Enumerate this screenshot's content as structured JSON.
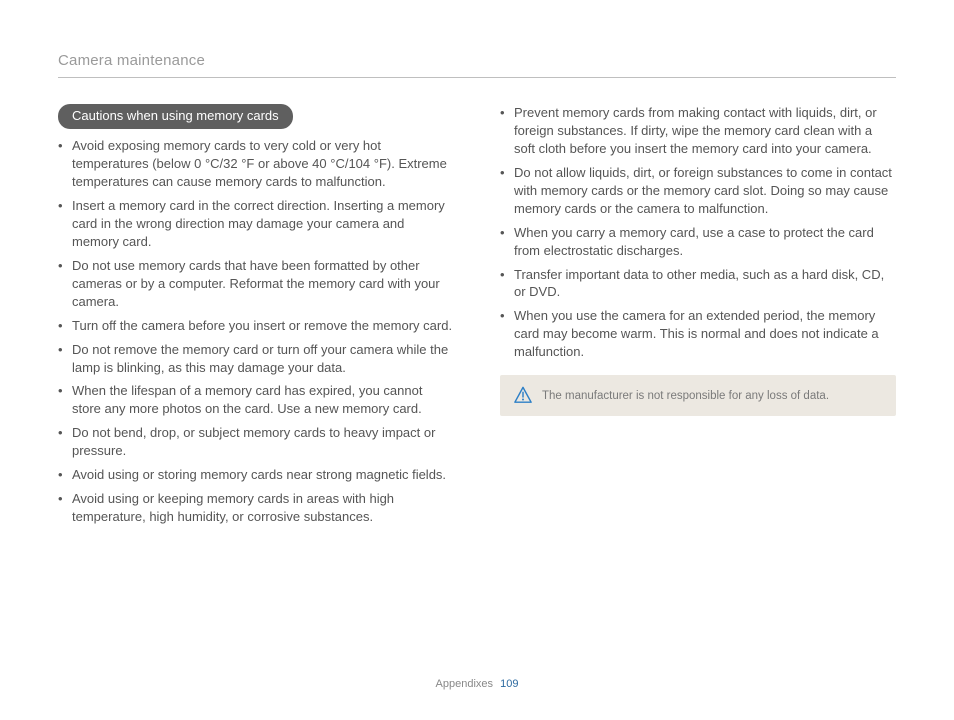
{
  "header": {
    "title": "Camera maintenance"
  },
  "section": {
    "heading": "Cautions when using memory cards"
  },
  "left_bullets": [
    "Avoid exposing memory cards to very cold or very hot temperatures (below 0 °C/32 °F or above 40 °C/104 °F). Extreme temperatures can cause memory cards to malfunction.",
    "Insert a memory card in the correct direction. Inserting a memory card in the wrong direction may damage your camera and memory card.",
    "Do not use memory cards that have been formatted by other cameras or by a computer. Reformat the memory card with your camera.",
    "Turn off the camera before you insert or remove the memory card.",
    "Do not remove the memory card or turn off your camera while the lamp is blinking, as this may damage your data.",
    "When the lifespan of a memory card has expired, you cannot store any more photos on the card. Use a new memory card.",
    "Do not bend, drop, or subject memory cards to heavy impact or pressure.",
    "Avoid using or storing memory cards near strong magnetic fields.",
    "Avoid using or keeping memory cards in areas with high temperature, high humidity, or corrosive substances."
  ],
  "right_bullets": [
    "Prevent memory cards from making contact with liquids, dirt, or foreign substances. If dirty, wipe the memory card clean with a soft cloth before you insert the memory card into your camera.",
    "Do not allow liquids, dirt, or foreign substances to come in contact with memory cards or the memory card slot. Doing so may cause memory cards or the camera to malfunction.",
    "When you carry a memory card, use a case to protect the card from electrostatic discharges.",
    "Transfer important data to other media, such as a hard disk, CD, or DVD.",
    "When you use the camera for an extended period, the memory card may become warm. This is normal and does not indicate a malfunction."
  ],
  "note": {
    "text": "The manufacturer is not responsible for any loss of data."
  },
  "footer": {
    "label": "Appendixes",
    "page": "109"
  }
}
